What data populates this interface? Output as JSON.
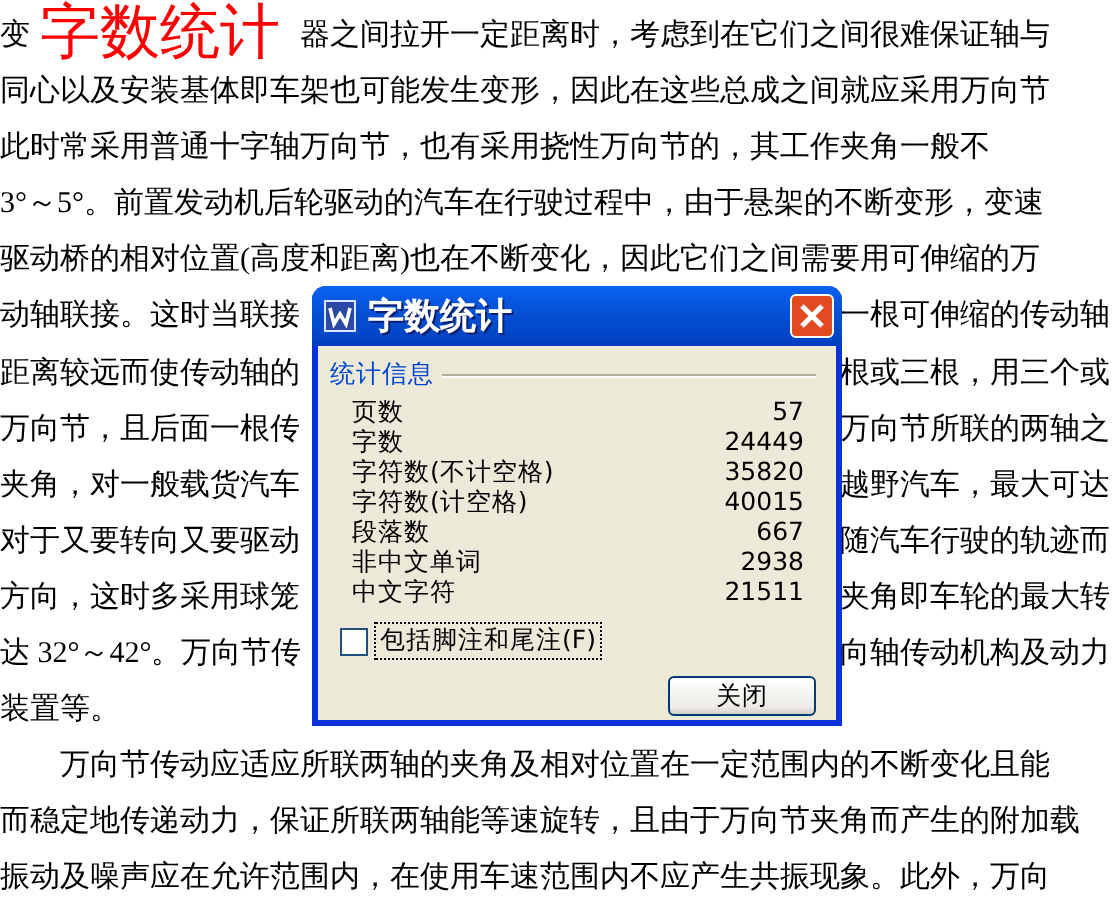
{
  "overlay_title": "字数统计",
  "document": {
    "lines": [
      {
        "kind": "titled",
        "left": "变",
        "right": "器之间拉开一定距离时，考虑到在它们之间很难保证轴与"
      },
      {
        "kind": "full",
        "text": "同心以及安装基体即车架也可能发生变形，因此在这些总成之间就应采用万向节"
      },
      {
        "kind": "full",
        "text": "此时常采用普通十字轴万向节，也有采用挠性万向节的，其工作夹角一般不"
      },
      {
        "kind": "full",
        "text": "3°～5°。前置发动机后轮驱动的汽车在行驶过程中，由于悬架的不断变形，变速"
      },
      {
        "kind": "full",
        "text": "驱动桥的相对位置(高度和距离)也在不断变化，因此它们之间需要用可伸缩的万"
      },
      {
        "kind": "split",
        "left": "动轴联接。这时当联接",
        "right": "一根可伸缩的传动轴"
      },
      {
        "kind": "split",
        "left": "距离较远而使传动轴的",
        "right": "根或三根，用三个或"
      },
      {
        "kind": "split",
        "left": "万向节，且后面一根传",
        "right": "万向节所联的两轴之"
      },
      {
        "kind": "split",
        "left": "夹角，对一般载货汽车",
        "right": "越野汽车，最大可达"
      },
      {
        "kind": "split",
        "left": "对于又要转向又要驱动",
        "right": "随汽车行驶的轨迹而"
      },
      {
        "kind": "split",
        "left": "方向，这时多采用球笼",
        "right": "夹角即车轮的最大转"
      },
      {
        "kind": "split",
        "left": "达 32°～42°。万向节传",
        "right": "向轴传动机构及动力"
      },
      {
        "kind": "full",
        "text": "装置等。"
      },
      {
        "kind": "indent",
        "text": "万向节传动应适应所联两轴的夹角及相对位置在一定范围内的不断变化且能"
      },
      {
        "kind": "full",
        "text": "而稳定地传递动力，保证所联两轴能等速旋转，且由于万向节夹角而产生的附加载"
      },
      {
        "kind": "full",
        "text": "振动及噪声应在允许范围内，在使用车速范围内不应产生共振现象。此外，万向"
      }
    ]
  },
  "dialog": {
    "title": "字数统计",
    "section": "统计信息",
    "stats": [
      {
        "label": "页数",
        "value": "57"
      },
      {
        "label": "字数",
        "value": "24449"
      },
      {
        "label": "字符数(不计空格)",
        "value": "35820"
      },
      {
        "label": "字符数(计空格)",
        "value": "40015"
      },
      {
        "label": "段落数",
        "value": "667"
      },
      {
        "label": "非中文单词",
        "value": "2938"
      },
      {
        "label": "中文字符",
        "value": "21511"
      }
    ],
    "checkbox": {
      "label": "包括脚注和尾注(F)",
      "checked": false
    },
    "button": "关闭"
  }
}
